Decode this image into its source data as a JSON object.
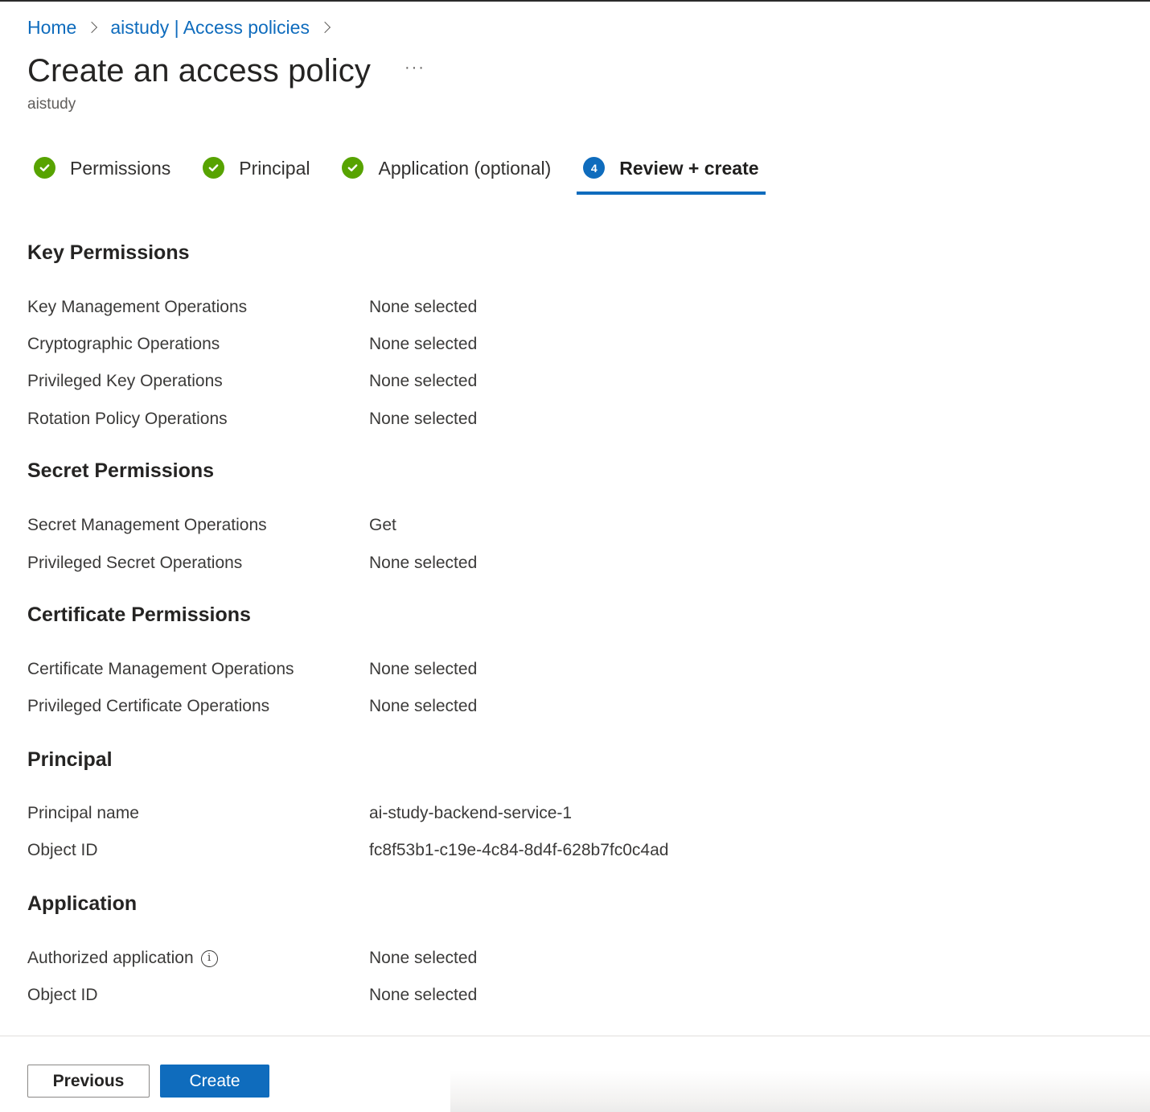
{
  "breadcrumb": [
    {
      "label": "Home"
    },
    {
      "label": "aistudy | Access policies"
    }
  ],
  "header": {
    "title": "Create an access policy",
    "more_icon": "ellipsis-icon",
    "more_label": "···",
    "subtitle": "aistudy"
  },
  "tabs": [
    {
      "label": "Permissions",
      "state": "complete",
      "icon": "checkmark-circle-icon"
    },
    {
      "label": "Principal",
      "state": "complete",
      "icon": "checkmark-circle-icon"
    },
    {
      "label": "Application (optional)",
      "state": "complete",
      "icon": "checkmark-circle-icon"
    },
    {
      "label": "Review + create",
      "state": "active",
      "step": "4"
    }
  ],
  "sections": {
    "key_permissions": {
      "title": "Key Permissions",
      "rows": [
        {
          "label": "Key Management Operations",
          "value": "None selected"
        },
        {
          "label": "Cryptographic Operations",
          "value": "None selected"
        },
        {
          "label": "Privileged Key Operations",
          "value": "None selected"
        },
        {
          "label": "Rotation Policy Operations",
          "value": "None selected"
        }
      ]
    },
    "secret_permissions": {
      "title": "Secret Permissions",
      "rows": [
        {
          "label": "Secret Management Operations",
          "value": "Get"
        },
        {
          "label": "Privileged Secret Operations",
          "value": "None selected"
        }
      ]
    },
    "certificate_permissions": {
      "title": "Certificate Permissions",
      "rows": [
        {
          "label": "Certificate Management Operations",
          "value": "None selected"
        },
        {
          "label": "Privileged Certificate Operations",
          "value": "None selected"
        }
      ]
    },
    "principal": {
      "title": "Principal",
      "rows": [
        {
          "label": "Principal name",
          "value": "ai-study-backend-service-1"
        },
        {
          "label": "Object ID",
          "value": "fc8f53b1-c19e-4c84-8d4f-628b7fc0c4ad"
        }
      ]
    },
    "application": {
      "title": "Application",
      "rows": [
        {
          "label": "Authorized application",
          "value": "None selected",
          "info_icon": "info-icon",
          "info_glyph": "i"
        },
        {
          "label": "Object ID",
          "value": "None selected"
        }
      ]
    }
  },
  "footer": {
    "previous_label": "Previous",
    "create_label": "Create"
  },
  "colors": {
    "accent": "#0f6cbd",
    "success": "#57a300",
    "text": "#323130"
  }
}
